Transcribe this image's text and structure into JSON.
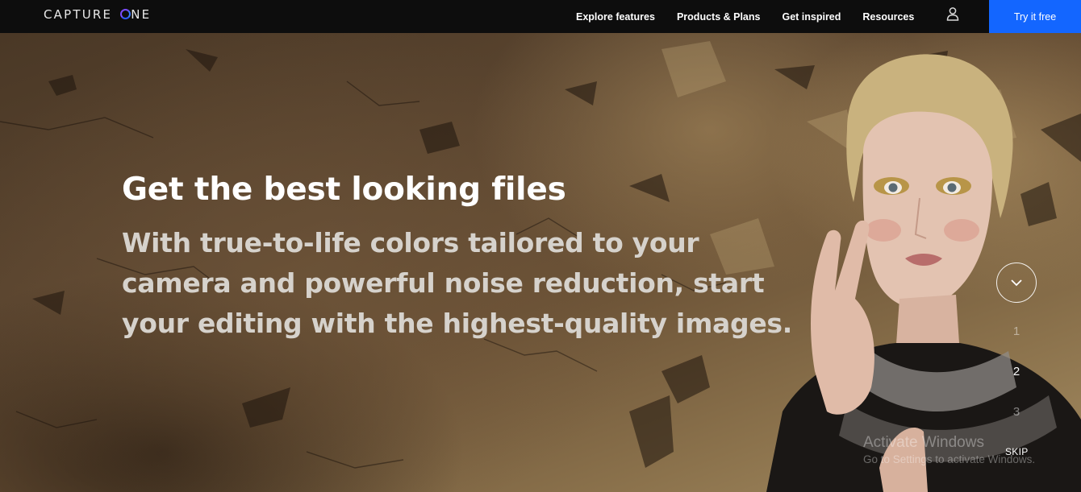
{
  "nav": {
    "logo_prefix": "CAPTURE ",
    "logo_suffix": "NE",
    "links": [
      "Explore features",
      "Products & Plans",
      "Get inspired",
      "Resources"
    ],
    "cta_label": "Try it free",
    "accent_color": "#1366ff",
    "user_icon": "user-icon"
  },
  "hero": {
    "headline": "Get the best looking files",
    "subline": "With true-to-life colors tailored to your camera and powerful noise reduction, start your editing with the highest-quality images.",
    "scroll_icon": "chevron-down-icon",
    "pager": [
      "1",
      "2",
      "3"
    ],
    "active_page": 1,
    "skip_label": "SKIP"
  },
  "os_watermark": {
    "title": "Activate Windows",
    "subtitle": "Go to Settings to activate Windows."
  }
}
